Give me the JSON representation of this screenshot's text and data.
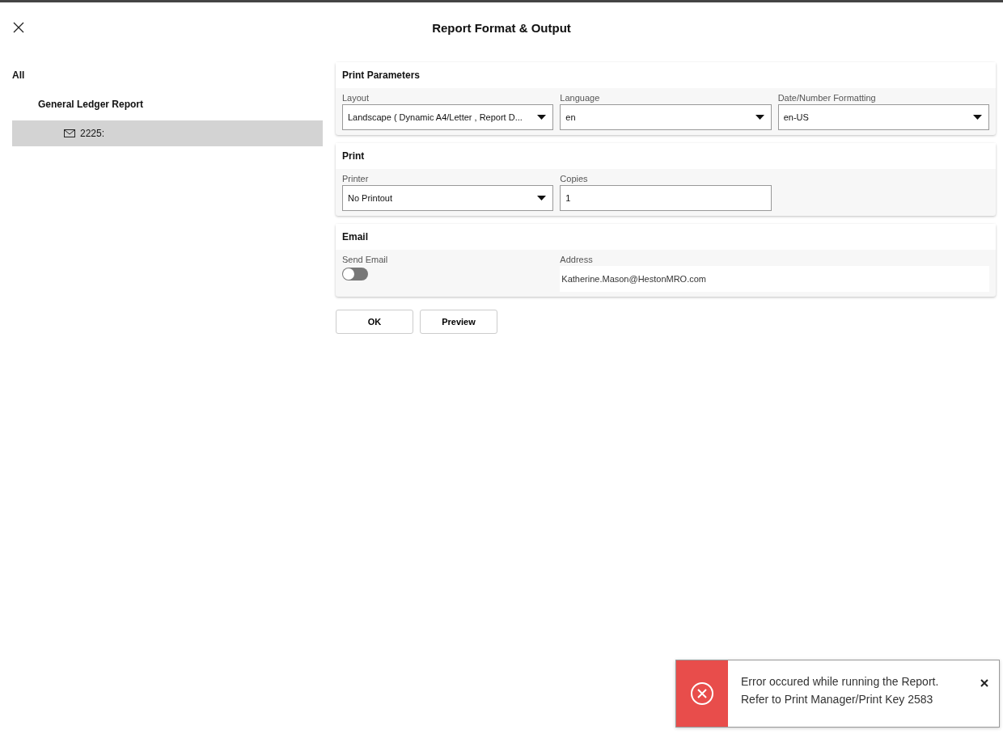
{
  "window": {
    "title": "Report Format & Output"
  },
  "tree": [
    {
      "label": "All",
      "selected": false,
      "children": [
        {
          "label": "General Ledger Report",
          "selected": false,
          "children": [
            {
              "label": "2225:",
              "selected": true
            }
          ]
        }
      ]
    }
  ],
  "sections": [
    {
      "title": "Print Parameters",
      "fields": [
        {
          "kind": "select",
          "label": "Layout",
          "value": "Landscape ( Dynamic A4/Letter , Report D..."
        },
        {
          "kind": "select",
          "label": "Language",
          "value": "en"
        },
        {
          "kind": "select",
          "label": "Date/Number Formatting",
          "value": "en-US"
        }
      ]
    },
    {
      "title": "Print",
      "fields": [
        {
          "kind": "select",
          "label": "Printer",
          "value": "No Printout"
        },
        {
          "kind": "text",
          "label": "Copies",
          "value": "1"
        }
      ]
    },
    {
      "title": "Email",
      "fields": [
        {
          "kind": "toggle",
          "label": "Send Email",
          "on": false
        },
        {
          "kind": "address",
          "label": "Address",
          "value": "Katherine.Mason@HestonMRO.com"
        }
      ]
    }
  ],
  "buttons": [
    "OK",
    "Preview"
  ],
  "toast": {
    "lines": [
      "Error occured while running the Report.",
      "Refer to Print Manager/Print Key 2583"
    ]
  }
}
